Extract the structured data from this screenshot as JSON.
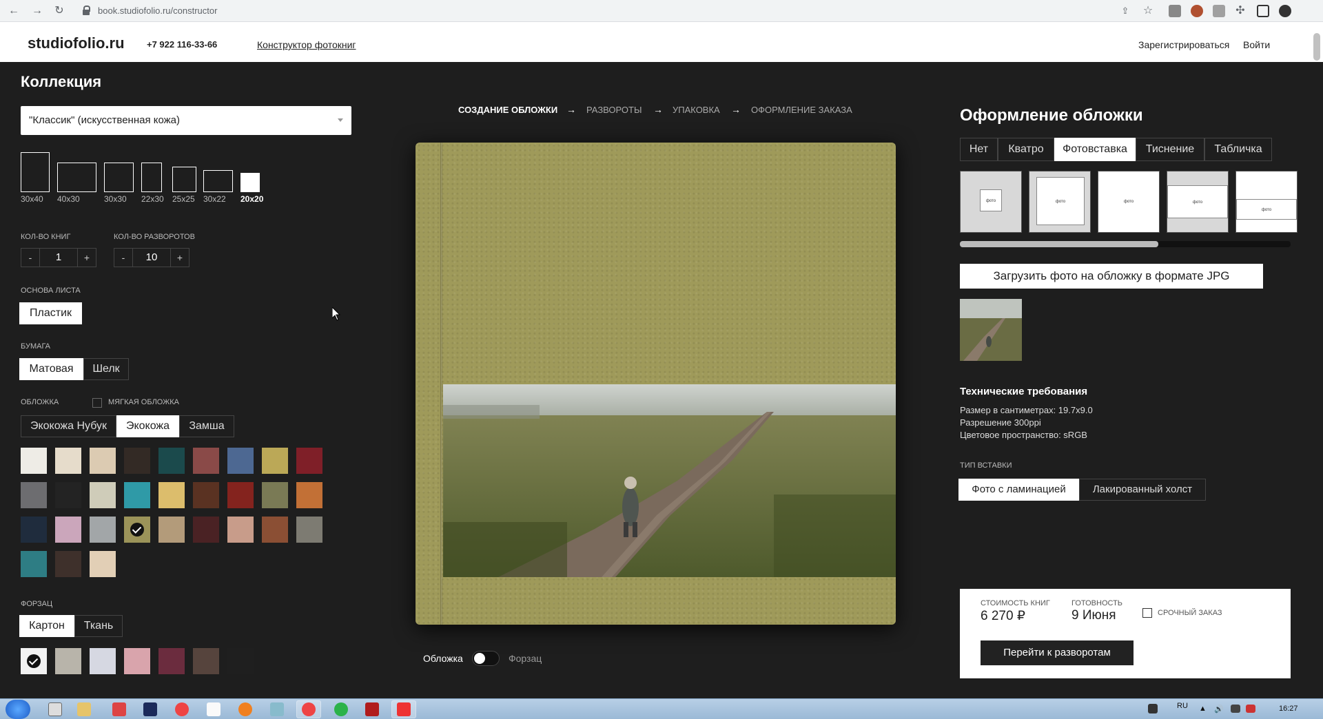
{
  "browser": {
    "url": "book.studiofolio.ru/constructor",
    "icons": [
      "back-icon",
      "forward-icon",
      "reload-icon",
      "lock-icon",
      "share-icon",
      "star-icon",
      "extension-icon",
      "puzzle-icon",
      "sidepanel-icon",
      "profile-icon"
    ]
  },
  "header": {
    "logo": "studiofolio.ru",
    "phone": "+7 922 116-33-66",
    "nav": "Конструктор фотокниг",
    "register": "Зарегистрироваться",
    "login": "Войти"
  },
  "left": {
    "title": "Коллекция",
    "collection_select": "\"Классик\" (искусственная кожа)",
    "sizes": [
      "30x40",
      "40x30",
      "30x30",
      "22x30",
      "25x25",
      "30x22",
      "20x20"
    ],
    "size_selected_index": 6,
    "books_label": "КОЛ-ВО КНИГ",
    "books_value": "1",
    "spreads_label": "КОЛ-ВО РАЗВОРОТОВ",
    "spreads_value": "10",
    "minus": "-",
    "plus": "+",
    "base_label": "ОСНОВА ЛИСТА",
    "base_options": [
      "Пластик"
    ],
    "paper_label": "БУМАГА",
    "paper_options": [
      "Матовая",
      "Шелк"
    ],
    "paper_selected_index": 0,
    "cover_label": "ОБЛОЖКА",
    "soft_cover_label": "МЯГКАЯ ОБЛОЖКА",
    "cover_material_options": [
      "Экокожа Нубук",
      "Экокожа",
      "Замша"
    ],
    "cover_material_selected_index": 1,
    "cover_colors": [
      "#eeece6",
      "#e6dccb",
      "#dccbb2",
      "#332a25",
      "#1b4a4c",
      "#8a4a48",
      "#4d6892",
      "#bba857",
      "#7f1f28",
      "#6d6d70",
      "#232323",
      "#cfccb9",
      "#2f9aa7",
      "#dcbd6c",
      "#5a3222",
      "#84231e",
      "#7a7a55",
      "#c27036",
      "#1f2c3d",
      "#cba6bb",
      "#a2a6a8",
      "#9b9359",
      "#b39b7a",
      "#4a2224",
      "#c89c8a",
      "#8b4f34",
      "#7d7b72",
      "#2e7d84",
      "#3e302b",
      "#e2cfb6"
    ],
    "cover_color_selected_index": 21,
    "endpaper_label": "ФОРЗАЦ",
    "endpaper_options": [
      "Картон",
      "Ткань"
    ],
    "endpaper_selected_index": 0,
    "endpaper_colors": [
      "#f2f2f2",
      "#b8b4aa",
      "#d6d8e2",
      "#d9a4ac",
      "#6b2c3e",
      "#56443d",
      "#1f1f1f"
    ],
    "endpaper_color_selected_index": 0
  },
  "center": {
    "steps": [
      "СОЗДАНИЕ ОБЛОЖКИ",
      "РАЗВОРОТЫ",
      "УПАКОВКА",
      "ОФОРМЛЕНИЕ ЗАКАЗА"
    ],
    "step_arrow": "→",
    "active_step_index": 0,
    "cover_color": "#9f9a5a",
    "toggle_left": "Обложка",
    "toggle_right": "Форзац"
  },
  "right": {
    "title": "Оформление обложки",
    "tabs": [
      "Нет",
      "Кватро",
      "Фотовставка",
      "Тиснение",
      "Табличка"
    ],
    "tab_selected_index": 2,
    "layout_label": "фото",
    "upload_button": "Загрузить фото на обложку в формате JPG",
    "tech_title": "Технические требования",
    "tech_lines": [
      "Размер в сантиметрах: 19.7x9.0",
      "Разрешение 300ppi",
      "Цветовое пространство: sRGB"
    ],
    "insert_type_label": "ТИП ВСТАВКИ",
    "insert_types": [
      "Фото с ламинацией",
      "Лакированный холст"
    ],
    "insert_selected_index": 0
  },
  "order": {
    "cost_label": "СТОИМОСТЬ КНИГ",
    "cost_value": "6 270 ₽",
    "ready_label": "ГОТОВНОСТЬ",
    "ready_value": "9 Июня",
    "urgent_label": "СРОЧНЫЙ ЗАКАЗ",
    "go_button": "Перейти к разворотам"
  },
  "taskbar": {
    "lang": "RU",
    "time": "16:27"
  }
}
